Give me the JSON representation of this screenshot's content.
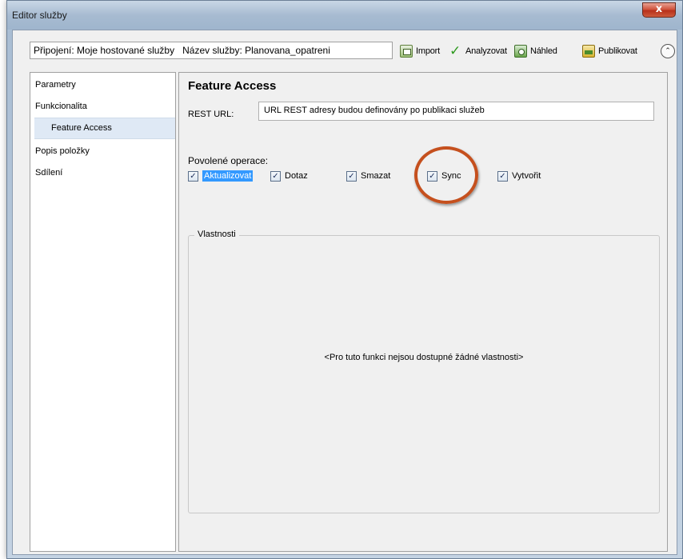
{
  "window": {
    "title": "Editor služby",
    "close_label": "x"
  },
  "toolbar": {
    "connection_label": "Připojení: Moje hostované služby",
    "service_name_label": "Název služby: Planovana_opatreni",
    "import_label": "Import",
    "analyze_label": "Analyzovat",
    "preview_label": "Náhled",
    "publish_label": "Publikovat",
    "collapse_glyph": "⌃"
  },
  "sidebar": {
    "items": [
      {
        "label": "Parametry"
      },
      {
        "label": "Funkcionalita"
      },
      {
        "label": "Feature Access",
        "selected": true
      },
      {
        "label": "Popis položky"
      },
      {
        "label": "Sdílení"
      }
    ]
  },
  "main": {
    "title": "Feature Access",
    "rest_url_label": "REST URL:",
    "rest_url_value": "URL REST adresy budou definovány po publikaci služeb",
    "operations_label": "Povolené operace:",
    "operations": [
      {
        "label": "Aktualizovat",
        "checked": true,
        "focused": true
      },
      {
        "label": "Dotaz",
        "checked": true
      },
      {
        "label": "Smazat",
        "checked": true
      },
      {
        "label": "Sync",
        "checked": true,
        "annotated": true
      },
      {
        "label": "Vytvořit",
        "checked": true
      }
    ],
    "properties_legend": "Vlastnosti",
    "properties_empty": "<Pro tuto funkci nejsou dostupné žádné vlastnosti>"
  },
  "colors": {
    "selection_highlight": "#3399ff",
    "annotation_circle": "#c5501e",
    "sidebar_selected_bg": "#dfe9f5"
  },
  "icons": {
    "import": "import-icon",
    "analyze": "checkmark-icon",
    "preview": "preview-icon",
    "publish": "publish-icon",
    "collapse": "chevron-up-icon",
    "checkbox_mark": "✓"
  }
}
